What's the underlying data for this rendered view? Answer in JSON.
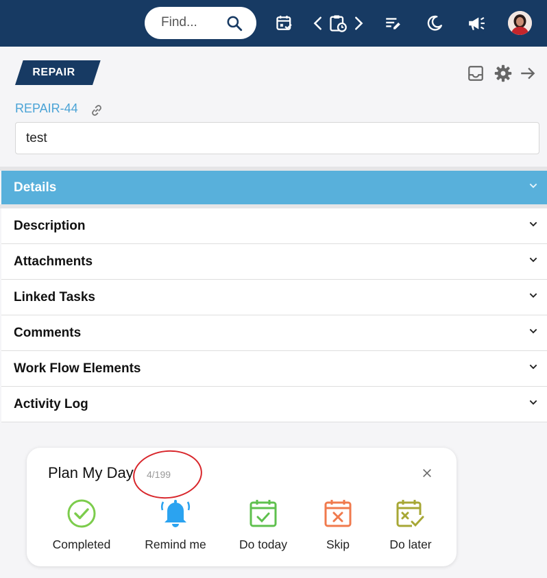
{
  "topbar": {
    "search_placeholder": "Find...",
    "icons": [
      "search-icon",
      "calendar-check-icon",
      "chevron-left-icon",
      "clipboard-clock-icon",
      "chevron-right-icon",
      "notes-edit-icon",
      "moon-icon",
      "megaphone-icon"
    ],
    "colors": {
      "background": "#173a63",
      "icon": "#ffffff"
    }
  },
  "header": {
    "badge": "REPAIR",
    "ticket_id": "REPAIR-44",
    "title_value": "test",
    "icons": [
      "inbox-icon",
      "gear-icon",
      "arrow-right-icon"
    ]
  },
  "sections": [
    {
      "label": "Details",
      "active": true
    },
    {
      "label": "Description",
      "active": false
    },
    {
      "label": "Attachments",
      "active": false
    },
    {
      "label": "Linked Tasks",
      "active": false
    },
    {
      "label": "Comments",
      "active": false
    },
    {
      "label": "Work Flow Elements",
      "active": false
    },
    {
      "label": "Activity Log",
      "active": false
    }
  ],
  "plan_my_day": {
    "title": "Plan My Day",
    "count": "4/199",
    "actions": [
      {
        "label": "Completed",
        "icon": "check-circle-icon",
        "color": "#7ccc4c"
      },
      {
        "label": "Remind me",
        "icon": "bell-icon",
        "color": "#2ba3f0"
      },
      {
        "label": "Do today",
        "icon": "calendar-check-icon",
        "color": "#5fc04e"
      },
      {
        "label": "Skip",
        "icon": "calendar-x-icon",
        "color": "#f07a4d"
      },
      {
        "label": "Do later",
        "icon": "calendar-later-icon",
        "color": "#a7a735"
      }
    ]
  },
  "colors": {
    "accent": "#58b0db",
    "link": "#4aa3d6",
    "annotation": "#d8262b"
  }
}
